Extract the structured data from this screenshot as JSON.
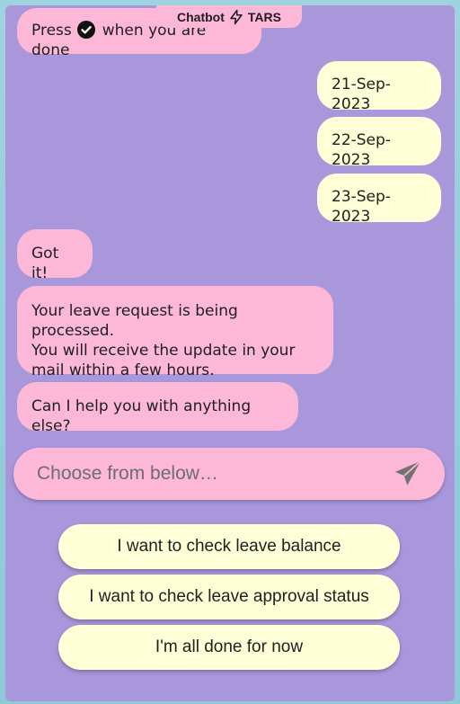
{
  "header": {
    "badge_prefix": "Chatbot",
    "badge_suffix": "TARS"
  },
  "messages": [
    {
      "from": "bot",
      "text_before_icon": "Press",
      "icon": "check-circle-icon",
      "text_after_icon": "when you are done"
    },
    {
      "from": "user",
      "text": "21-Sep-2023"
    },
    {
      "from": "user",
      "text": "22-Sep-2023"
    },
    {
      "from": "user",
      "text": "23-Sep-2023"
    },
    {
      "from": "bot",
      "text": "Got it!"
    },
    {
      "from": "bot",
      "lines": [
        "Your leave request is being processed.",
        "You will receive the update in your",
        "mail within a few hours."
      ]
    },
    {
      "from": "bot",
      "text": "Can I help you with anything else?"
    }
  ],
  "input": {
    "placeholder": "Choose from below…",
    "send_icon": "send-icon"
  },
  "quick_replies": [
    "I want to check leave balance",
    "I want to check leave approval status",
    "I'm all done for now"
  ],
  "colors": {
    "panel_bg": "#a997dc",
    "bot_bubble": "#fcb8d6",
    "user_bubble": "#fefed7",
    "page_bg": "#9fd3df"
  }
}
